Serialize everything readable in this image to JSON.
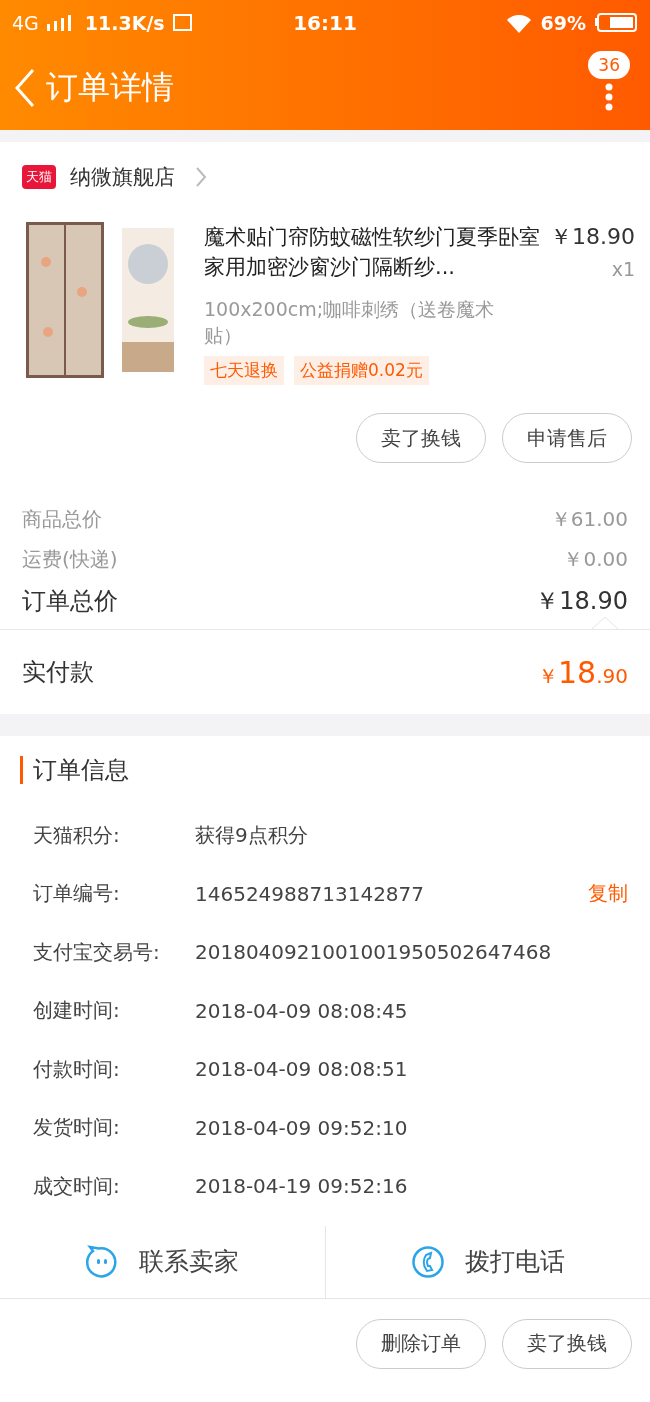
{
  "status_bar": {
    "network": "4G",
    "speed": "11.3K/s",
    "time": "16:11",
    "battery": "69%"
  },
  "header": {
    "title": "订单详情",
    "badge": "36"
  },
  "store": {
    "name": "纳微旗舰店",
    "badge": "天猫"
  },
  "product": {
    "kind": "picture",
    "title": "魔术贴门帘防蚊磁性软纱门夏季卧室家用加密沙窗沙门隔断纱...",
    "price": "￥18.90",
    "quantity": "x1",
    "spec": "100x200cm;咖啡刺绣（送卷魔术贴）",
    "tags": [
      "七天退换",
      "公益捐赠0.02元"
    ]
  },
  "product_actions": [
    "卖了换钱",
    "申请售后"
  ],
  "price_rows": [
    {
      "kind": "minor",
      "label": "商品总价",
      "value": "￥61.00"
    },
    {
      "kind": "minor",
      "label": "运费(快递)",
      "value": "￥0.00"
    },
    {
      "kind": "major",
      "label": "订单总价",
      "value": "￥18.90"
    }
  ],
  "paid": {
    "label": "实付款",
    "currency": "￥",
    "integer": "18",
    "decimal": ".90"
  },
  "order_info": {
    "title": "订单信息",
    "rows": [
      {
        "label": "天猫积分:",
        "value": "获得9点积分"
      },
      {
        "label": "订单编号:",
        "value": "146524988713142877",
        "action": "复制"
      },
      {
        "label": "支付宝交易号:",
        "value": "2018040921001001950502647468"
      },
      {
        "label": "创建时间:",
        "value": "2018-04-09 08:08:45"
      },
      {
        "label": "付款时间:",
        "value": "2018-04-09 08:08:51"
      },
      {
        "label": "发货时间:",
        "value": "2018-04-09 09:52:10"
      },
      {
        "label": "成交时间:",
        "value": "2018-04-19 09:52:16"
      }
    ]
  },
  "contact": [
    {
      "kind": "chat",
      "label": "联系卖家"
    },
    {
      "kind": "phone",
      "label": "拨打电话"
    }
  ],
  "bottom_actions": [
    "删除订单",
    "卖了换钱"
  ]
}
